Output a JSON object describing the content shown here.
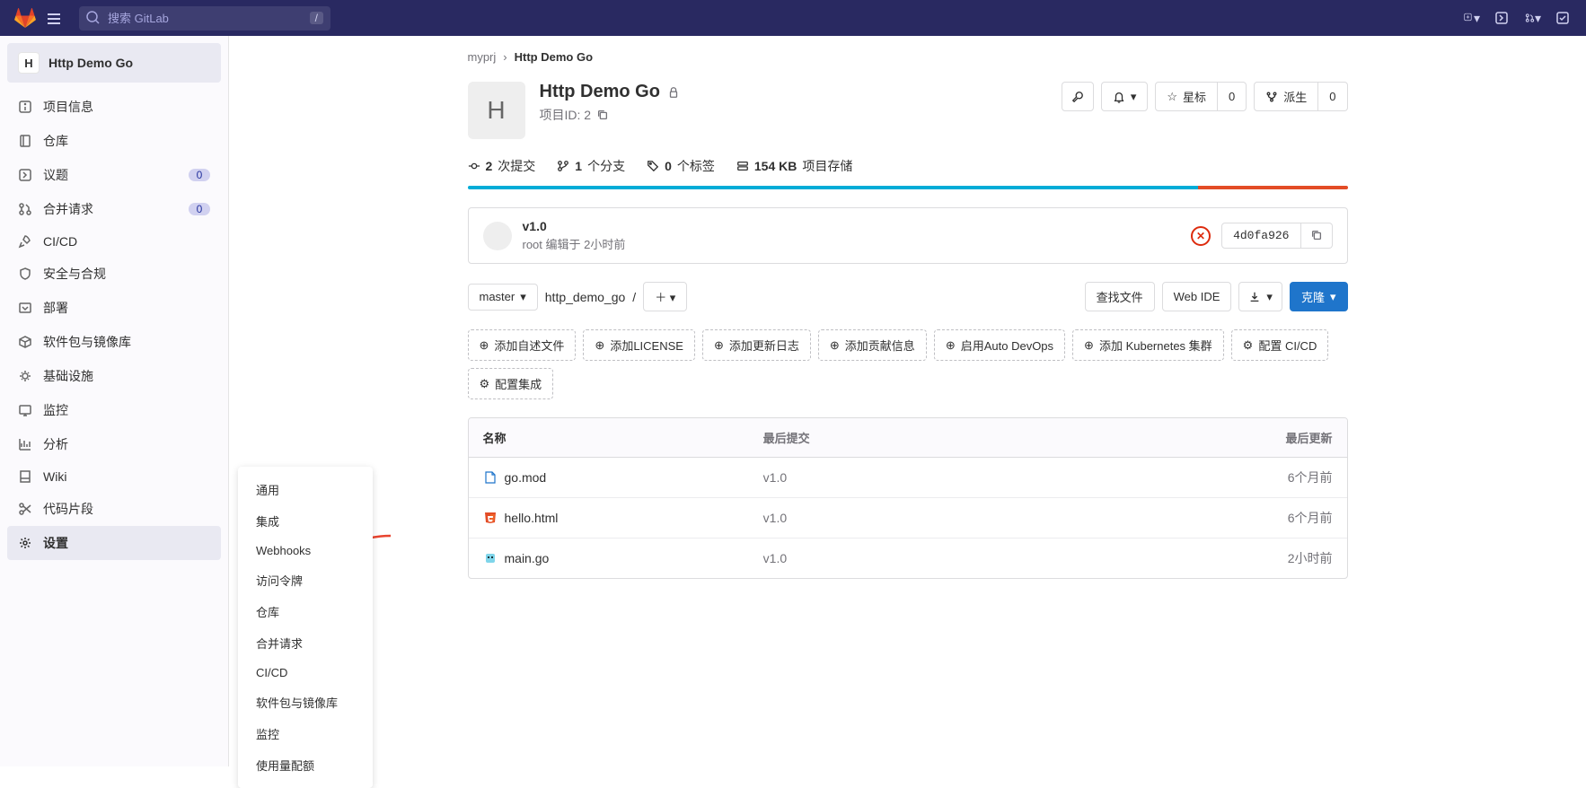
{
  "search_placeholder": "搜索 GitLab",
  "search_shortcut": "/",
  "sidebar": {
    "project_avatar_letter": "H",
    "project_name": "Http Demo Go",
    "items": [
      {
        "label": "项目信息"
      },
      {
        "label": "仓库"
      },
      {
        "label": "议题",
        "badge": "0"
      },
      {
        "label": "合并请求",
        "badge": "0"
      },
      {
        "label": "CI/CD"
      },
      {
        "label": "安全与合规"
      },
      {
        "label": "部署"
      },
      {
        "label": "软件包与镜像库"
      },
      {
        "label": "基础设施"
      },
      {
        "label": "监控"
      },
      {
        "label": "分析"
      },
      {
        "label": "Wiki"
      },
      {
        "label": "代码片段"
      },
      {
        "label": "设置"
      }
    ]
  },
  "flyout": {
    "items": [
      "通用",
      "集成",
      "Webhooks",
      "访问令牌",
      "仓库",
      "合并请求",
      "CI/CD",
      "软件包与镜像库",
      "监控",
      "使用量配额"
    ]
  },
  "breadcrumbs": {
    "group": "myprj",
    "project": "Http Demo Go"
  },
  "project": {
    "avatar_letter": "H",
    "title": "Http Demo Go",
    "id_label": "项目ID: 2"
  },
  "actions": {
    "star": "星标",
    "star_count": "0",
    "fork": "派生",
    "fork_count": "0"
  },
  "stats": {
    "commits_count": "2",
    "commits_label": "次提交",
    "branches_count": "1",
    "branches_label": "个分支",
    "tags_count": "0",
    "tags_label": "个标签",
    "storage_size": "154 KB",
    "storage_label": "项目存储"
  },
  "commit": {
    "title": "v1.0",
    "author": "root",
    "edited_text": "编辑于",
    "time": "2小时前",
    "sha": "4d0fa926"
  },
  "controls": {
    "branch": "master",
    "path": "http_demo_go",
    "path_sep": "/",
    "find": "查找文件",
    "webide": "Web IDE",
    "clone": "克隆"
  },
  "suggestions": [
    "添加自述文件",
    "添加LICENSE",
    "添加更新日志",
    "添加贡献信息",
    "启用Auto DevOps",
    "添加 Kubernetes 集群",
    "配置 CI/CD",
    "配置集成"
  ],
  "table": {
    "head_name": "名称",
    "head_commit": "最后提交",
    "head_updated": "最后更新",
    "rows": [
      {
        "name": "go.mod",
        "commit": "v1.0",
        "updated": "6个月前",
        "icon_color": "#1f75cb",
        "type": "text"
      },
      {
        "name": "hello.html",
        "commit": "v1.0",
        "updated": "6个月前",
        "icon_color": "#e34c26",
        "type": "html"
      },
      {
        "name": "main.go",
        "commit": "v1.0",
        "updated": "2小时前",
        "icon_color": "#7dd3c0",
        "type": "go"
      }
    ]
  }
}
